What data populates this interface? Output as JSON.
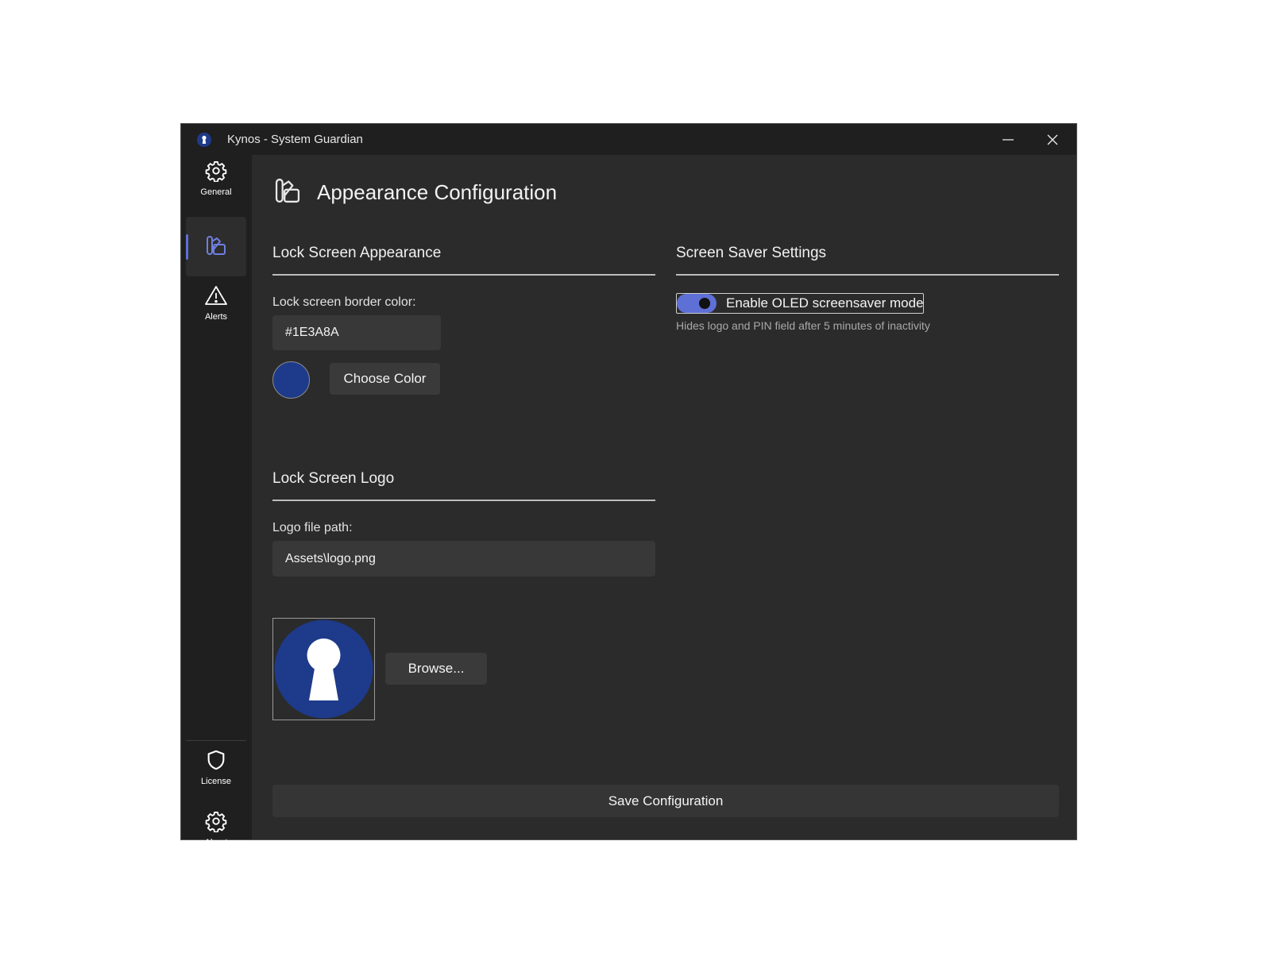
{
  "window": {
    "title": "Kynos - System Guardian",
    "controls": {
      "minimize_icon": "minimize-icon",
      "close_icon": "close-icon"
    }
  },
  "sidebar": {
    "items": [
      {
        "label": "General",
        "icon": "gear-icon"
      },
      {
        "label": "",
        "icon": "palette-icon",
        "selected": true
      },
      {
        "label": "Alerts",
        "icon": "warning-icon"
      },
      {
        "label": "License",
        "icon": "shield-icon"
      },
      {
        "label": "About",
        "icon": "gear-icon"
      }
    ]
  },
  "page": {
    "title": "Appearance Configuration",
    "icon": "palette-icon"
  },
  "lock_screen_appearance": {
    "title": "Lock Screen Appearance",
    "border_color_label": "Lock screen border color:",
    "border_color_value": "#1E3A8A",
    "choose_color_button": "Choose Color"
  },
  "lock_screen_logo": {
    "title": "Lock Screen Logo",
    "path_label": "Logo file path:",
    "path_value": "Assets\\logo.png",
    "browse_button": "Browse..."
  },
  "screen_saver": {
    "title": "Screen Saver Settings",
    "oled_toggle_label": "Enable OLED screensaver mode",
    "oled_toggle_on": true,
    "oled_hint": "Hides logo and PIN field after 5 minutes of inactivity"
  },
  "save_button": "Save Configuration",
  "colors": {
    "accent": "#5E6FD6",
    "swatch": "#1E3A8A",
    "background": "#2B2B2B",
    "sidebar": "#1F1F1F"
  }
}
